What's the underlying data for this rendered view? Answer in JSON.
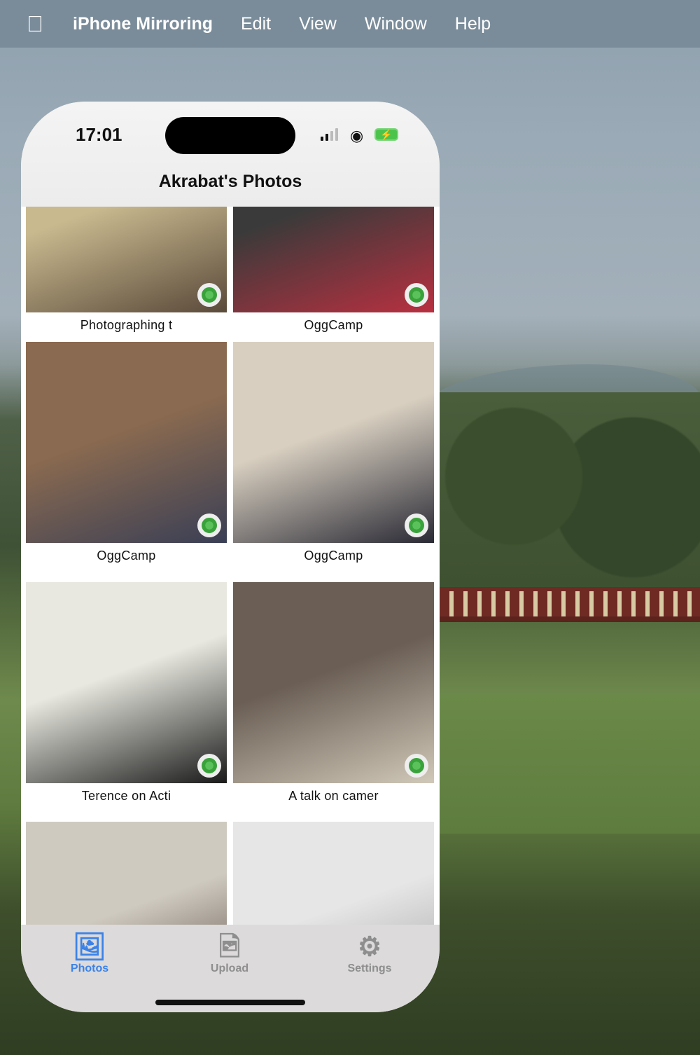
{
  "menubar": {
    "apple_icon": "apple-logo",
    "app": "iPhone Mirroring",
    "items": [
      "Edit",
      "View",
      "Window",
      "Help"
    ]
  },
  "status": {
    "time": "17:01",
    "signal_bars": 2,
    "battery_charging": true
  },
  "header": {
    "title": "Akrabat's Photos"
  },
  "photos": [
    {
      "caption": "Photographing t",
      "colors": [
        "#c9b98f",
        "#5a4a3a"
      ]
    },
    {
      "caption": "OggCamp",
      "colors": [
        "#3a3a3a",
        "#b83040"
      ]
    },
    {
      "caption": "OggCamp",
      "colors": [
        "#8a6a50",
        "#3a3f55"
      ]
    },
    {
      "caption": "OggCamp",
      "colors": [
        "#d8cfc0",
        "#2a2a35"
      ]
    },
    {
      "caption": "Terence on Acti",
      "colors": [
        "#e8e8e0",
        "#1a1a1a"
      ]
    },
    {
      "caption": "A talk on camer",
      "colors": [
        "#6b5f55",
        "#d0c8b8"
      ]
    },
    {
      "caption": "",
      "colors": [
        "#cfcac0",
        "#4a3a30"
      ]
    },
    {
      "caption": "",
      "colors": [
        "#e6e6e6",
        "#9a9a9a"
      ]
    }
  ],
  "tabs": [
    {
      "label": "Photos",
      "icon": "photo-stack",
      "active": true
    },
    {
      "label": "Upload",
      "icon": "photo-badge-plus",
      "active": false
    },
    {
      "label": "Settings",
      "icon": "gear",
      "active": false
    }
  ],
  "colors": {
    "accent": "#3b82e8",
    "globe": "#3aa23a"
  }
}
